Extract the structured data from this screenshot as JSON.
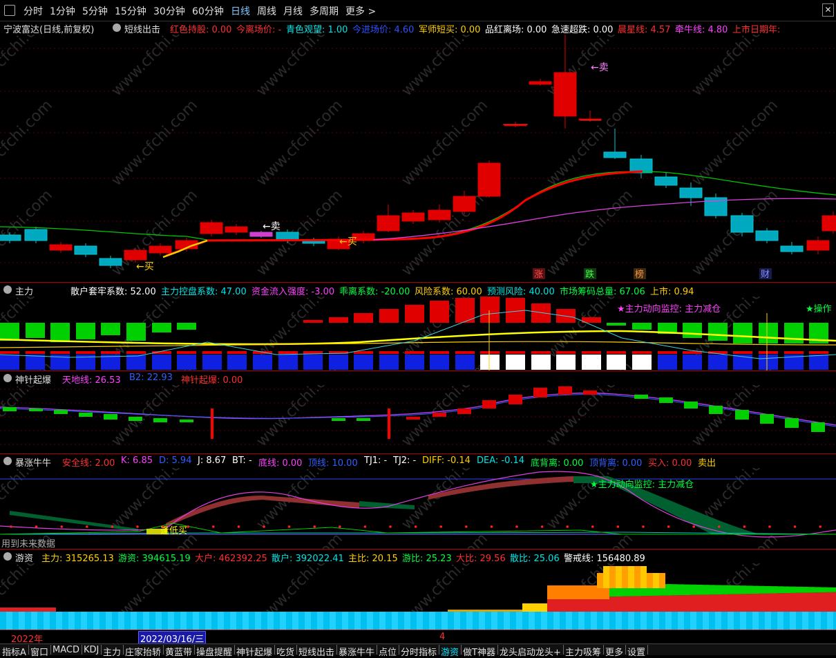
{
  "toolbar": {
    "items": [
      "分时",
      "1分钟",
      "5分钟",
      "15分钟",
      "30分钟",
      "60分钟",
      "日线",
      "周线",
      "月线",
      "多周期",
      "更多 >"
    ],
    "active": "日线"
  },
  "main_panel": {
    "title": "宁波富达(日线,前复权)",
    "indicator": "短线出击",
    "fields": [
      {
        "label": "红色持股: 0.00",
        "color": "#ff3030"
      },
      {
        "label": "今离场价: -",
        "color": "#ff3030"
      },
      {
        "label": "青色观望: 1.00",
        "color": "#00e5e5"
      },
      {
        "label": "今进场价: 4.60",
        "color": "#3050ff"
      },
      {
        "label": "军师短买: 0.00",
        "color": "#ffd000"
      },
      {
        "label": "品红离场: 0.00",
        "color": "#ffffff"
      },
      {
        "label": "急速超跌: 0.00",
        "color": "#ffffff"
      },
      {
        "label": "晨星线: 4.57",
        "color": "#ff3030"
      },
      {
        "label": "牵牛线: 4.80",
        "color": "#ff40ff"
      },
      {
        "label": "上市日期年:",
        "color": "#ff3030"
      }
    ],
    "annotations": {
      "sell1": "←卖",
      "sell2": "←卖",
      "buy1": "←买",
      "buy2": "←买"
    },
    "badges": [
      "涨",
      "跌",
      "榜",
      "财"
    ]
  },
  "zhuli_panel": {
    "name": "主力",
    "fields": [
      {
        "label": "散户套牢系数: 52.00",
        "color": "#ffffff"
      },
      {
        "label": "主力控盘系数: 47.00",
        "color": "#00e5e5"
      },
      {
        "label": "资金流入强度: -3.00",
        "color": "#ff40ff"
      },
      {
        "label": "乖离系数: -20.00",
        "color": "#00ff40"
      },
      {
        "label": "风险系数: 60.00",
        "color": "#ffd000"
      },
      {
        "label": "预测风险: 40.00",
        "color": "#00e5e5"
      },
      {
        "label": "市场筹码总量: 67.06",
        "color": "#00ff40"
      },
      {
        "label": "上市: 0.94",
        "color": "#ffd000"
      }
    ],
    "notes": [
      "★主力动向监控: 主力减仓",
      "★操作"
    ]
  },
  "shenzhen_panel": {
    "name": "神针起爆",
    "fields": [
      {
        "label": "天地线: 26.53",
        "color": "#ff40ff"
      },
      {
        "label": "B2: 22.93",
        "color": "#3060ff"
      },
      {
        "label": "神针起爆: 0.00",
        "color": "#ff3030"
      }
    ]
  },
  "baozhang_panel": {
    "name": "暴涨牛牛",
    "fields": [
      {
        "label": "安全线: 2.00",
        "color": "#ff3030"
      },
      {
        "label": "K: 6.85",
        "color": "#ff40ff"
      },
      {
        "label": "D: 5.94",
        "color": "#3060ff"
      },
      {
        "label": "J: 8.67",
        "color": "#ffffff"
      },
      {
        "label": "BT: -",
        "color": "#ffffff"
      },
      {
        "label": "底线: 0.00",
        "color": "#ff40ff"
      },
      {
        "label": "顶线: 10.00",
        "color": "#3060ff"
      },
      {
        "label": "TJ1: -",
        "color": "#ffffff"
      },
      {
        "label": "TJ2: -",
        "color": "#ffffff"
      },
      {
        "label": "DIFF: -0.14",
        "color": "#ffd000"
      },
      {
        "label": "DEA: -0.14",
        "color": "#00e5e5"
      },
      {
        "label": "底背离: 0.00",
        "color": "#00ff40"
      },
      {
        "label": "顶背离: 0.00",
        "color": "#3060ff"
      },
      {
        "label": "买入: 0.00",
        "color": "#ff3030"
      },
      {
        "label": "卖出",
        "color": "#ffd000"
      }
    ],
    "note": "★主力动向监控: 主力减仓",
    "buy_label": "逢低买",
    "future_warning": "用到未来数据"
  },
  "youzi_panel": {
    "name": "游资",
    "fields": [
      {
        "label": "主力: 315265.13",
        "color": "#ffd000"
      },
      {
        "label": "游资: 394615.19",
        "color": "#00ff40"
      },
      {
        "label": "大户: 462392.25",
        "color": "#ff3030"
      },
      {
        "label": "散户: 392022.41",
        "color": "#00e5e5"
      },
      {
        "label": "主比: 20.15",
        "color": "#ffd000"
      },
      {
        "label": "游比: 25.23",
        "color": "#00ff40"
      },
      {
        "label": "大比: 29.56",
        "color": "#ff3030"
      },
      {
        "label": "散比: 25.06",
        "color": "#00e5e5"
      },
      {
        "label": "警戒线: 156480.89",
        "color": "#ffffff"
      }
    ]
  },
  "time_axis": {
    "year": "2022年",
    "cursor": "2022/03/16/三",
    "month": "4"
  },
  "bottom_tabs": {
    "items": [
      "指标A",
      "窗口",
      "MACD",
      "KDJ",
      "主力",
      "庄家抬轿",
      "黄蓝带",
      "操盘提醒",
      "神针起爆",
      "吃货",
      "短线出击",
      "暴涨牛牛",
      "点位",
      "分时指标",
      "游资",
      "做T神器",
      "龙头启动龙头+",
      "主力吸筹",
      "更多",
      "设置"
    ],
    "active": "游资"
  },
  "watermark": "www.cfchi.com"
}
